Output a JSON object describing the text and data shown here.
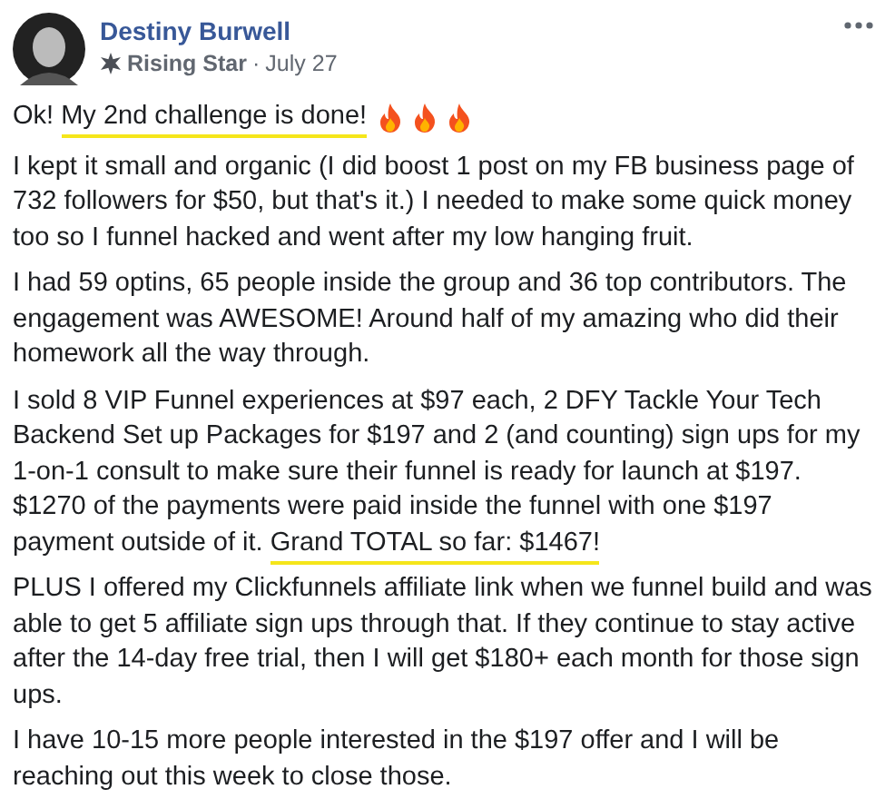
{
  "post": {
    "author": "Destiny Burwell",
    "badge": "Rising Star",
    "separator": "·",
    "date": "July 27",
    "paragraphs": [
      [
        {
          "text": "Ok! ",
          "highlighted": false
        },
        {
          "text": "My 2nd challenge is done!",
          "highlighted": true
        }
      ],
      [
        {
          "text": "I kept it small and organic (I did boost 1 post on my FB business page of 732 followers for $50, but that's it.) I needed to make some quick money too so I funnel hacked and went after my low hanging fruit.",
          "highlighted": false
        }
      ],
      [
        {
          "text": "I had 59 optins, 65 people inside the group and 36 top contributors. The engagement was AWESOME! Around half of my amazing who did their homework all the way through.",
          "highlighted": false
        }
      ],
      [
        {
          "text": "I sold 8 VIP Funnel experiences at $97 each, 2 DFY Tackle Your Tech Backend Set up Packages for $197 and 2 (and counting) sign ups for my 1-on-1 consult to make sure their funnel is ready for launch at $197. $1270 of the payments were paid inside the funnel with one $197 payment outside of it. ",
          "highlighted": false
        },
        {
          "text": "Grand TOTAL so far: $1467!",
          "highlighted": true
        }
      ],
      [
        {
          "text": "PLUS I offered my Clickfunnels affiliate link when we funnel build and was able to get 5 affiliate sign ups through that. If they continue to stay active after the 14-day free trial, then I will get $180+ each month for those sign ups.",
          "highlighted": false
        }
      ],
      [
        {
          "text": "I have 10-15 more people interested in the $197 offer and I will be reaching out this week to close those.",
          "highlighted": false
        }
      ]
    ]
  }
}
